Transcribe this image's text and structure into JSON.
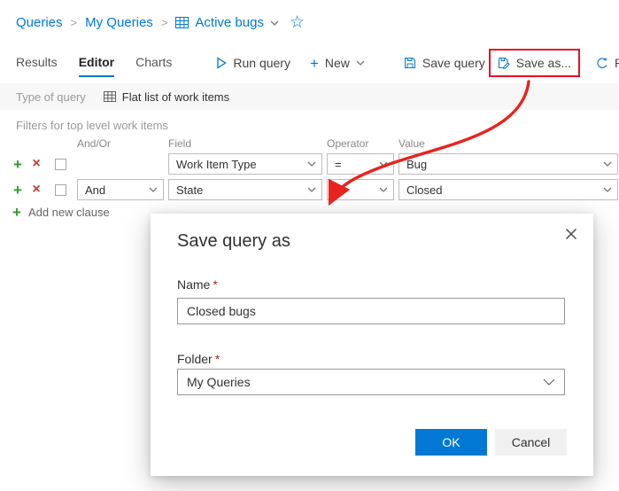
{
  "breadcrumb": {
    "separator": ">",
    "items": [
      "Queries",
      "My Queries",
      "Active bugs"
    ]
  },
  "icons": {
    "star_outline": "☆",
    "plus": "+",
    "cross": "×"
  },
  "tabs": [
    {
      "label": "Results",
      "active": false
    },
    {
      "label": "Editor",
      "active": true
    },
    {
      "label": "Charts",
      "active": false
    }
  ],
  "toolbar": {
    "run_query_label": "Run query",
    "new_label": "New",
    "save_query_label": "Save query",
    "save_as_label": "Save as...",
    "revert_label_partial": "Re"
  },
  "query_type_bar": {
    "label": "Type of query",
    "value": "Flat list of work items"
  },
  "filters": {
    "section_title": "Filters for top level work items",
    "columns": {
      "and_or": "And/Or",
      "field": "Field",
      "operator": "Operator",
      "value": "Value"
    },
    "rows": [
      {
        "and_or": "",
        "field": "Work Item Type",
        "operator": "=",
        "value": "Bug"
      },
      {
        "and_or": "And",
        "field": "State",
        "operator": "=",
        "value": "Closed"
      }
    ],
    "add_clause_label": "Add new clause"
  },
  "dialog": {
    "title": "Save query as",
    "required_mark": "*",
    "name_label": "Name",
    "name_value": "Closed bugs",
    "folder_label": "Folder",
    "folder_value": "My Queries",
    "ok_label": "OK",
    "cancel_label": "Cancel"
  },
  "colors": {
    "accent_blue": "#0078d4",
    "highlight_red": "#e81123",
    "add_green": "#2e9b2e",
    "remove_red": "#d13438"
  }
}
